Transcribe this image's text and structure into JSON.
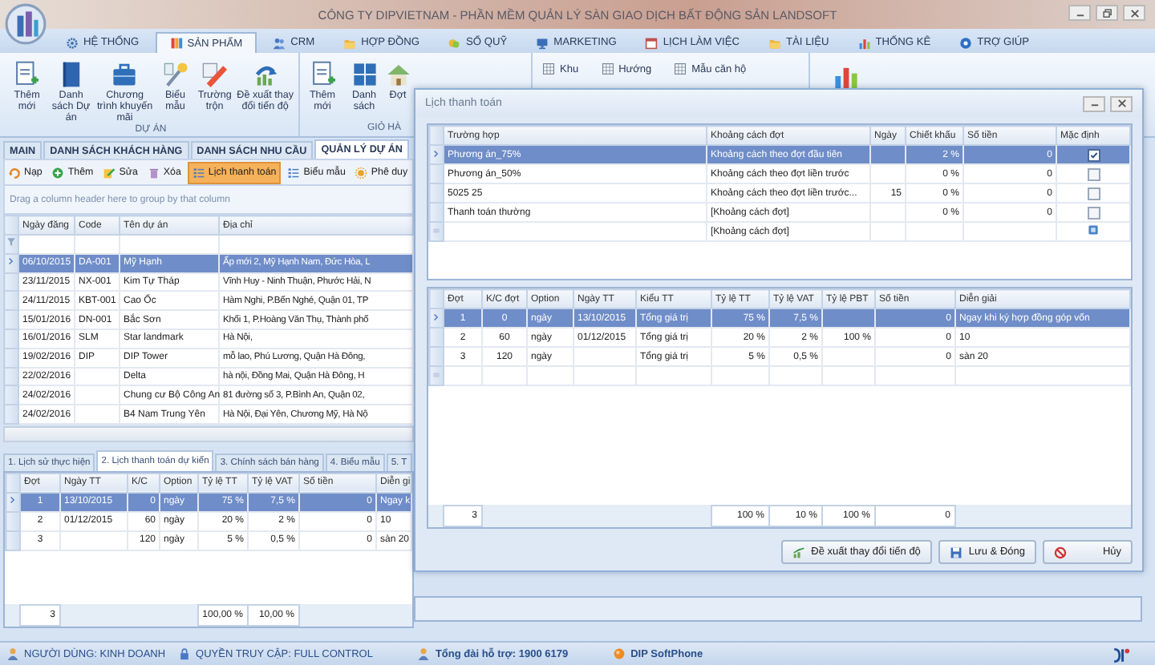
{
  "window": {
    "title": "CÔNG TY DIPVIETNAM - PHẦN MỀM QUẢN LÝ SÀN GIAO DỊCH BẤT ĐỘNG SẢN LANDSOFT"
  },
  "menu_tabs": [
    {
      "label": "HỆ THỐNG",
      "selected": false
    },
    {
      "label": "SẢN PHẨM",
      "selected": true
    },
    {
      "label": "CRM",
      "selected": false
    },
    {
      "label": "HỢP ĐỒNG",
      "selected": false
    },
    {
      "label": "SỔ QUỸ",
      "selected": false
    },
    {
      "label": "MARKETING",
      "selected": false
    },
    {
      "label": "LỊCH LÀM VIỆC",
      "selected": false
    },
    {
      "label": "TÀI LIỆU",
      "selected": false
    },
    {
      "label": "THỐNG KÊ",
      "selected": false
    },
    {
      "label": "TRỢ GIÚP",
      "selected": false
    }
  ],
  "ribbon": {
    "groups": [
      {
        "label": "DỰ ÁN",
        "buttons": [
          "Thêm mới",
          "Danh sách Dự án",
          "Chương trình khuyến mãi",
          "Biểu mẫu",
          "Trường trộn",
          "Đề xuất thay đổi tiến độ"
        ]
      },
      {
        "label": "GIỎ HÀ",
        "buttons": [
          "Thêm mới",
          "Danh sách",
          "Đợt"
        ]
      }
    ],
    "small_buttons": [
      "Khu",
      "Hướng",
      "Mẫu căn hộ"
    ]
  },
  "page_tabs": [
    {
      "label": "MAIN",
      "selected": false
    },
    {
      "label": "DANH SÁCH KHÁCH HÀNG",
      "selected": false
    },
    {
      "label": "DANH SÁCH NHU CẦU",
      "selected": false
    },
    {
      "label": "QUẢN LÝ DỰ ÁN",
      "selected": true
    }
  ],
  "toolbar": [
    {
      "label": "Nạp",
      "selected": false
    },
    {
      "label": "Thêm",
      "selected": false
    },
    {
      "label": "Sửa",
      "selected": false
    },
    {
      "label": "Xóa",
      "selected": false
    },
    {
      "label": "Lịch thanh toán",
      "selected": true
    },
    {
      "label": "Biểu mẫu",
      "selected": false
    },
    {
      "label": "Phê duy",
      "selected": false
    }
  ],
  "group_hint": "Drag a column header here to group by that column",
  "projects": {
    "columns": [
      "Ngày đăng",
      "Code",
      "Tên dự án",
      "Địa chỉ"
    ],
    "rows": [
      {
        "cells": [
          "06/10/2015",
          "DA-001",
          "Mỹ Hạnh",
          "Ấp mới 2, Mỹ Hạnh Nam, Đức Hòa, L"
        ],
        "selected": true
      },
      {
        "cells": [
          "23/11/2015",
          "NX-001",
          "Kim Tự Tháp",
          "Vĩnh Huy - Ninh Thuận, Phước Hải, N"
        ],
        "selected": false
      },
      {
        "cells": [
          "24/11/2015",
          "KBT-001",
          "Cao Ốc",
          "Hàm Nghi, P.Bến Nghé, Quận 01, TP"
        ],
        "selected": false
      },
      {
        "cells": [
          "15/01/2016",
          "DN-001",
          "Bắc Sơn",
          "Khối 1, P.Hoàng Văn Thụ, Thành phố"
        ],
        "selected": false
      },
      {
        "cells": [
          "16/01/2016",
          "SLM",
          "Star landmark",
          "Hà Nội,"
        ],
        "selected": false
      },
      {
        "cells": [
          "19/02/2016",
          "DIP",
          "DIP Tower",
          "mỗ lao, Phú Lương, Quận Hà Đông,"
        ],
        "selected": false
      },
      {
        "cells": [
          "22/02/2016",
          null,
          "Delta",
          "hà nội, Đồng Mai, Quận Hà Đông, H"
        ],
        "selected": false
      },
      {
        "cells": [
          "24/02/2016",
          null,
          "Chung cư Bộ Công An",
          "81 đường số 3, P.Bình An, Quận 02,"
        ],
        "selected": false
      },
      {
        "cells": [
          "24/02/2016",
          null,
          "B4 Nam Trung Yên",
          "Hà Nội, Đại Yên, Chương Mỹ, Hà Nộ"
        ],
        "selected": false
      }
    ]
  },
  "detail_tabs": [
    {
      "label": "1. Lịch sử thực hiện",
      "selected": false
    },
    {
      "label": "2. Lịch thanh toán dự kiến",
      "selected": true
    },
    {
      "label": "3. Chính sách bán hàng",
      "selected": false
    },
    {
      "label": "4. Biểu mẫu",
      "selected": false
    },
    {
      "label": "5. T",
      "selected": false
    }
  ],
  "schedule": {
    "columns": [
      "Đợt",
      "Ngày TT",
      "K/C",
      "Option",
      "Tỷ lệ TT",
      "Tỷ lệ VAT",
      "Số tiền",
      "Diễn gi"
    ],
    "rows": [
      {
        "cells": [
          "1",
          "13/10/2015",
          "0",
          "ngày",
          "75 %",
          "7,5 %",
          "0",
          "Ngay k"
        ],
        "selected": true
      },
      {
        "cells": [
          "2",
          "01/12/2015",
          "60",
          "ngày",
          "20 %",
          "2 %",
          "0",
          "10"
        ],
        "selected": false
      },
      {
        "cells": [
          "3",
          null,
          "120",
          "ngày",
          "5 %",
          "0,5 %",
          "0",
          "sàn 20"
        ],
        "selected": false
      }
    ],
    "footer": {
      "dot": "3",
      "ty_le_tt": "100,00 %",
      "ty_le_vat": "10,00 %"
    }
  },
  "status_bar": [
    "NGƯỜI DÙNG: KINH DOANH",
    "QUYỀN TRUY CẬP: FULL CONTROL",
    "Tổng đài hỗ trợ: 1900 6179",
    "DIP SoftPhone"
  ],
  "dialog": {
    "title": "Lịch thanh toán",
    "cases": {
      "columns": [
        "Trường hợp",
        "Khoảng cách đợt",
        "Ngày",
        "Chiết khấu",
        "Số tiền",
        "Mặc định"
      ],
      "rows": [
        {
          "kind": "data",
          "cells": [
            "Phương án_75%",
            "Khoảng cách theo đợt đầu tiên",
            null,
            "2 %",
            "0"
          ],
          "default": true,
          "selected": true
        },
        {
          "kind": "data",
          "cells": [
            "Phương án_50%",
            "Khoảng cách theo đợt liền trước",
            null,
            "0 %",
            "0"
          ],
          "default": false,
          "selected": false
        },
        {
          "kind": "data",
          "cells": [
            "5025 25",
            "Khoảng cách theo đợt liền trước...",
            "15",
            "0 %",
            "0"
          ],
          "default": false,
          "selected": false
        },
        {
          "kind": "data",
          "cells": [
            "Thanh toán thường",
            "[Khoảng cách đợt]",
            null,
            "0 %",
            "0"
          ],
          "default": false,
          "selected": false
        },
        {
          "kind": "new",
          "cells": [
            null,
            "[Khoảng cách đợt]",
            null,
            null,
            null
          ],
          "selected": false
        }
      ]
    },
    "installments": {
      "columns": [
        "Đợt",
        "K/C đợt",
        "Option",
        "Ngày TT",
        "Kiểu TT",
        "Tỷ lệ TT",
        "Tỷ lệ VAT",
        "Tỷ lệ PBT",
        "Số tiền",
        "Diễn giải"
      ],
      "rows": [
        {
          "kind": "data",
          "cells": [
            "1",
            "0",
            "ngày",
            "13/10/2015",
            "Tổng giá trị",
            "75 %",
            "7,5 %",
            null,
            "0",
            "Ngay khi ký hợp đồng góp vốn"
          ],
          "selected": true
        },
        {
          "kind": "data",
          "cells": [
            "2",
            "60",
            "ngày",
            "01/12/2015",
            "Tổng giá trị",
            "20 %",
            "2 %",
            "100 %",
            "0",
            "10"
          ],
          "selected": false
        },
        {
          "kind": "data",
          "cells": [
            "3",
            "120",
            "ngày",
            null,
            "Tổng giá trị",
            "5 %",
            "0,5 %",
            null,
            "0",
            "sàn 20"
          ],
          "selected": false
        },
        {
          "kind": "new",
          "selected": false
        }
      ],
      "footer": {
        "dot": "3",
        "ty_le_tt": "100 %",
        "ty_le_vat": "10 %",
        "ty_le_pbt": "100 %",
        "so_tien": "0"
      }
    },
    "buttons": [
      "Đề xuất thay đổi tiến độ",
      "Lưu & Đóng",
      "Hủy"
    ]
  }
}
